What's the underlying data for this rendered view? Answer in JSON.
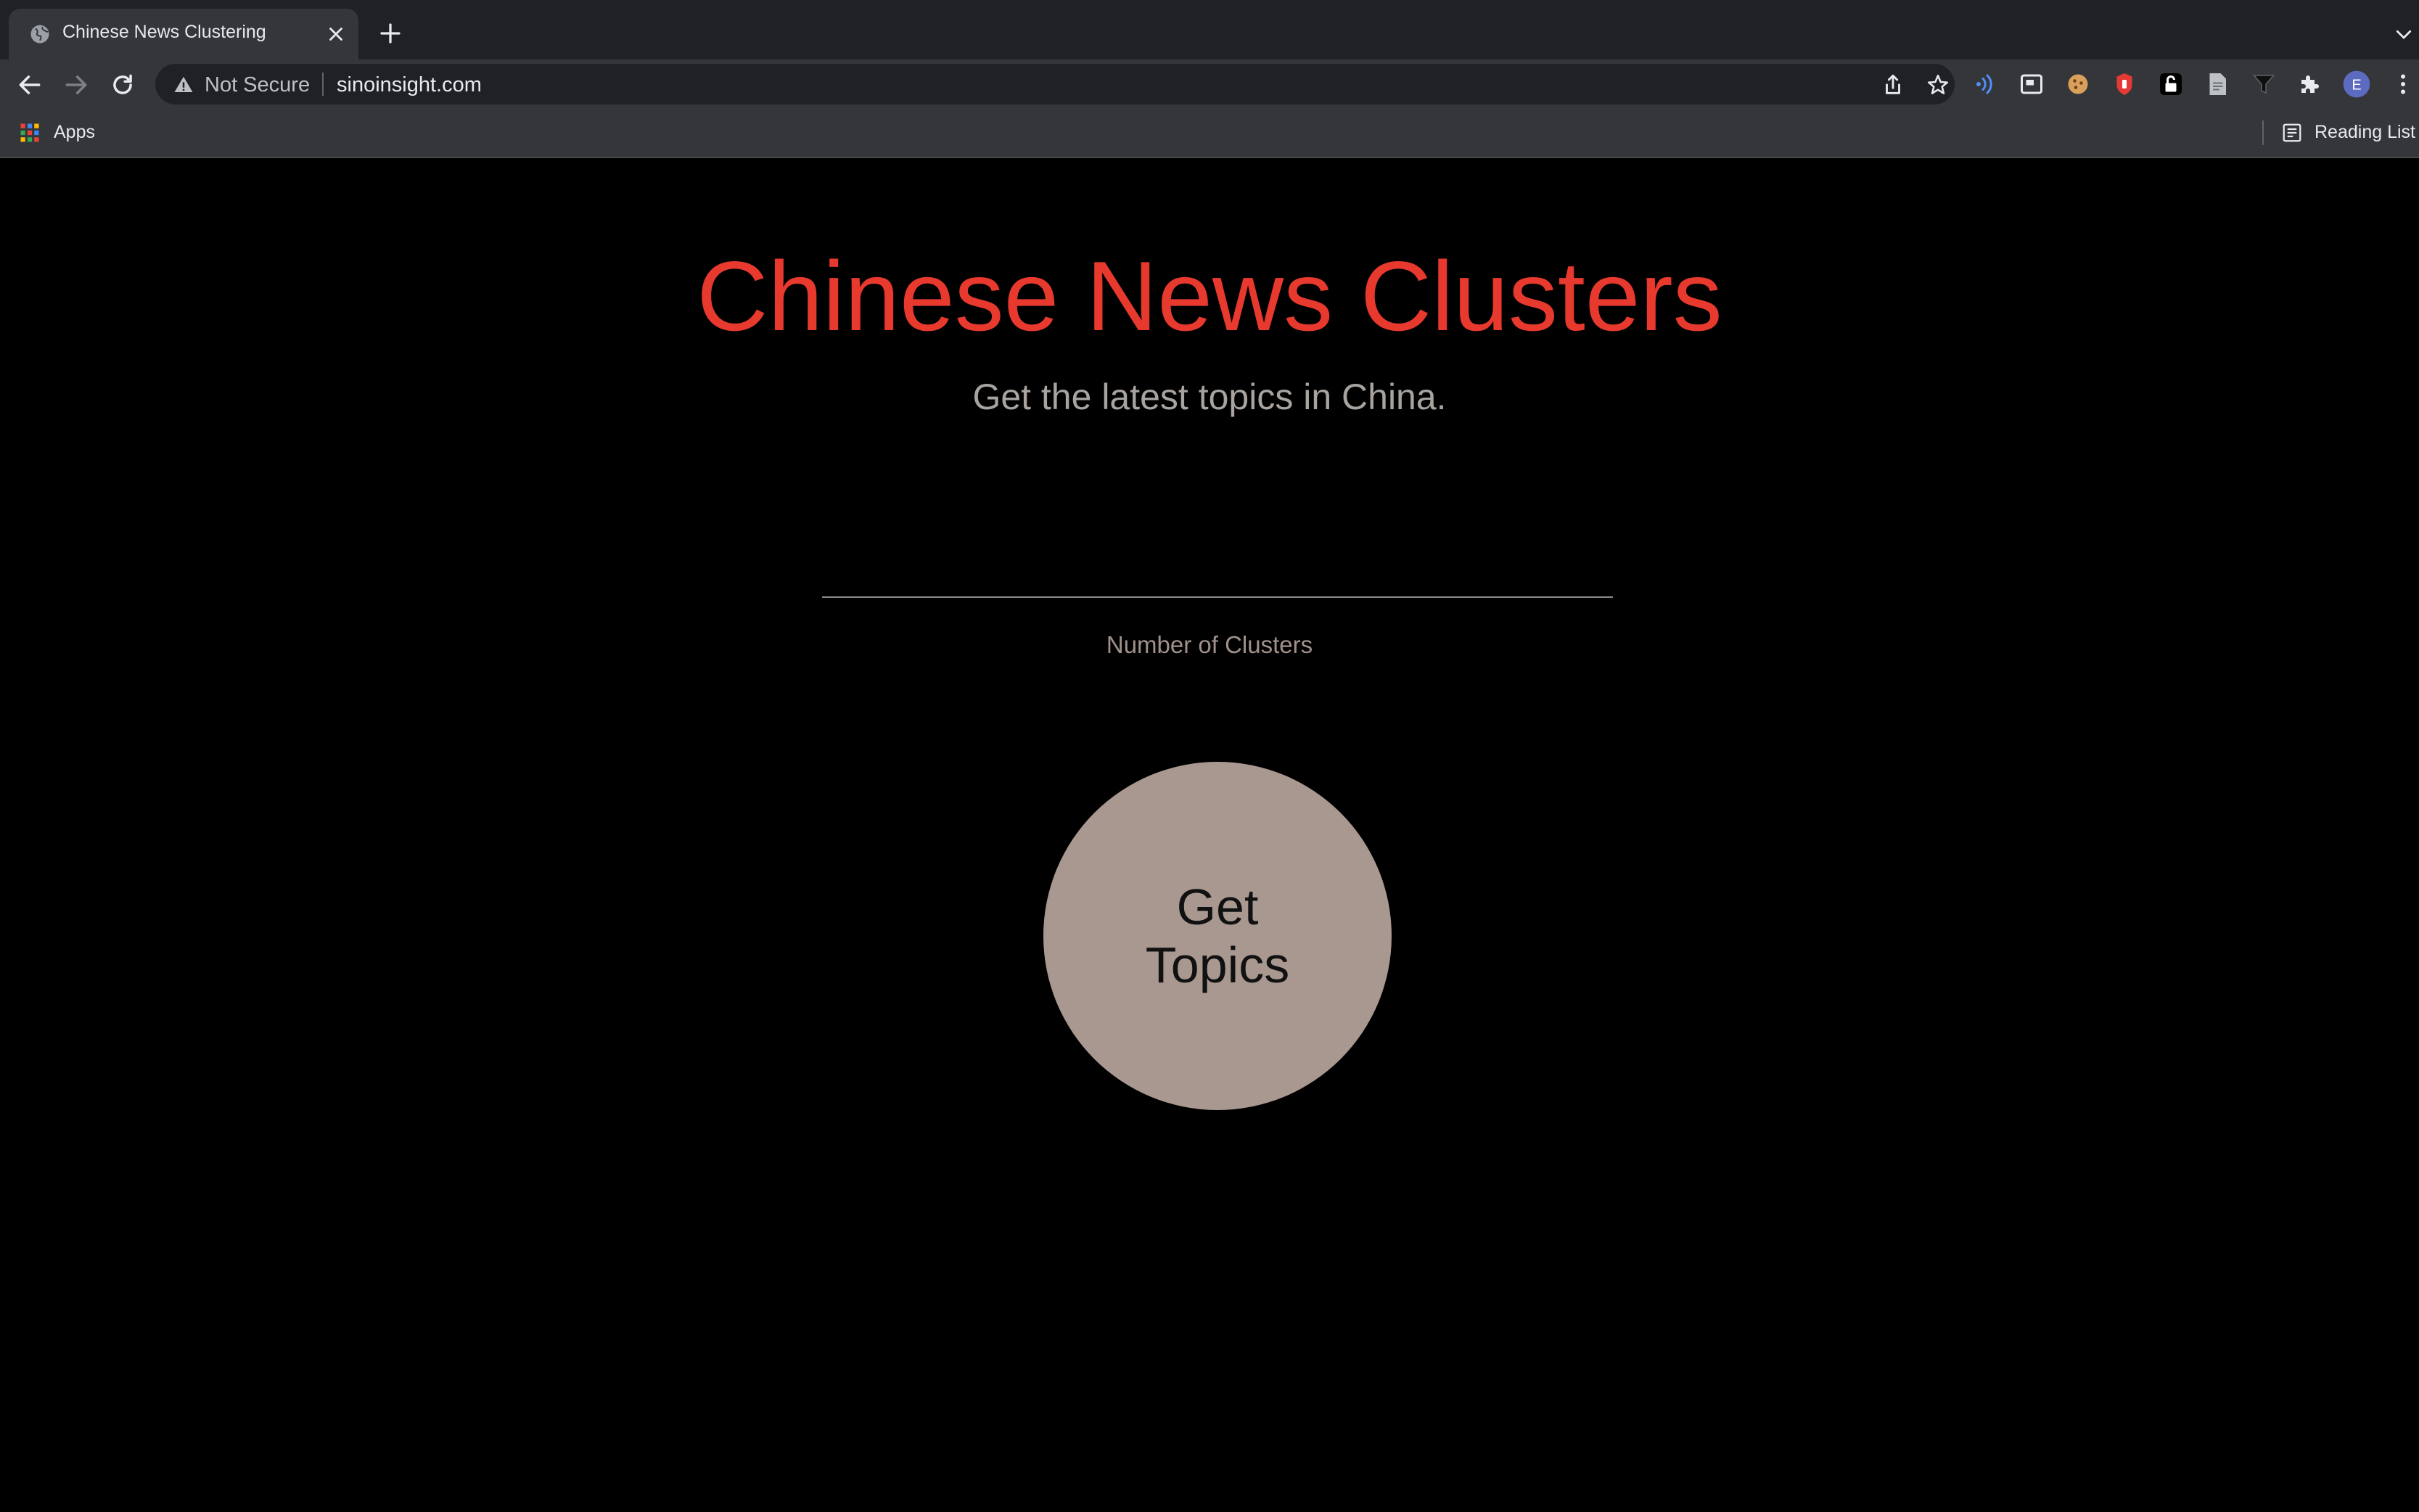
{
  "browser": {
    "tab": {
      "title": "Chinese News Clustering"
    },
    "address": {
      "security_label": "Not Secure",
      "url": "sinoinsight.com"
    },
    "bookmarks": {
      "apps_label": "Apps",
      "reading_list_label": "Reading List"
    },
    "profile_initial": "E"
  },
  "page": {
    "title": "Chinese News Clusters",
    "subtitle": "Get the latest topics in China.",
    "clusters_input": {
      "value": "",
      "label": "Number of Clusters"
    },
    "submit_button_label": "Get Topics",
    "colors": {
      "title": "#e8392e",
      "button": "#a89890",
      "background": "#000000"
    }
  }
}
